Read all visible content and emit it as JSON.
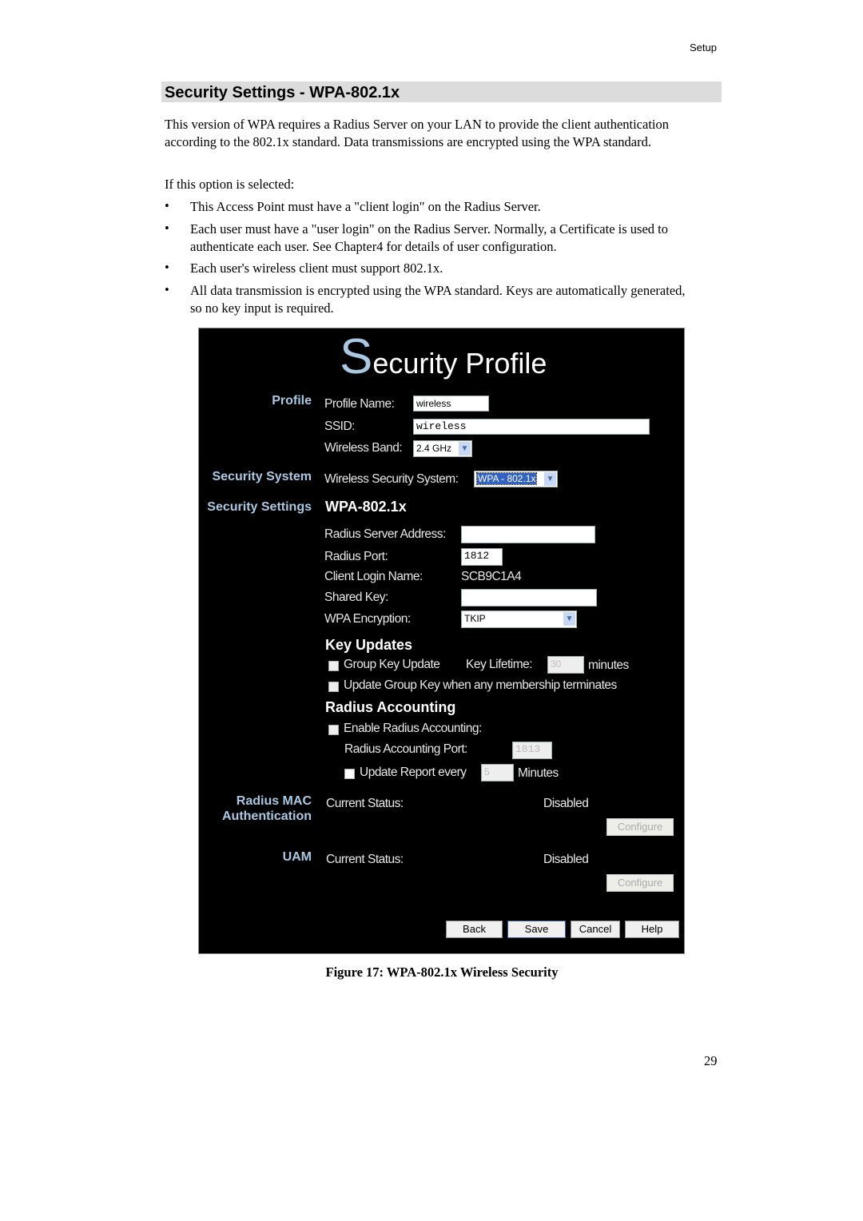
{
  "header": {
    "section": "Setup"
  },
  "title": "Security Settings - WPA-802.1x",
  "intro": "This version of WPA requires a Radius Server on your LAN to provide the client authentication according to the 802.1x standard. Data transmissions are encrypted using the WPA standard.",
  "if_selected": "If this option is selected:",
  "bullets": [
    "This Access Point must have a \"client login\" on the Radius Server.",
    "Each user must have a \"user login\" on the Radius Server. Normally, a Certificate is used to authenticate each user. See Chapter4 for details of user configuration.",
    "Each user's wireless client must support 802.1x.",
    "All data transmission is encrypted using the WPA standard. Keys are automatically generated, so no key input is required."
  ],
  "screen": {
    "title_initial": "S",
    "title_rest": "ecurity Profile",
    "sections": {
      "profile": "Profile",
      "security_system": "Security System",
      "security_settings": "Security Settings",
      "radius_mac": "Radius MAC",
      "authentication": "Authentication",
      "uam": "UAM"
    },
    "profile_name_label": "Profile Name:",
    "profile_name": "wireless",
    "ssid_label": "SSID:",
    "ssid": "wireless",
    "band_label": "Wireless Band:",
    "band": "2.4 GHz",
    "security_system_label": "Wireless Security System:",
    "security_system": "WPA - 802.1x",
    "settings_heading": "WPA-802.1x",
    "radius_server_label": "Radius Server Address:",
    "radius_server": "",
    "radius_port_label": "Radius Port:",
    "radius_port": "1812",
    "client_login_label": "Client Login Name:",
    "client_login": "SCB9C1A4",
    "shared_key_label": "Shared Key:",
    "shared_key": "",
    "encryption_label": "WPA Encryption:",
    "encryption": "TKIP",
    "key_updates_heading": "Key Updates",
    "group_key_update": "Group Key Update",
    "key_lifetime_label": "Key Lifetime:",
    "key_lifetime": "30",
    "minutes": "minutes",
    "update_on_terminate": "Update Group Key when any membership terminates",
    "radius_accounting_heading": "Radius Accounting",
    "enable_accounting": "Enable Radius Accounting:",
    "accounting_port_label": "Radius Accounting Port:",
    "accounting_port": "1813",
    "update_report": "Update Report every",
    "update_report_value": "5",
    "minutes_cap": "Minutes",
    "current_status_label": "Current Status:",
    "mac_status": "Disabled",
    "uam_status": "Disabled",
    "configure": "Configure",
    "buttons": {
      "back": "Back",
      "save": "Save",
      "cancel": "Cancel",
      "help": "Help"
    }
  },
  "caption": "Figure 17: WPA-802.1x Wireless Security",
  "page_number": "29"
}
